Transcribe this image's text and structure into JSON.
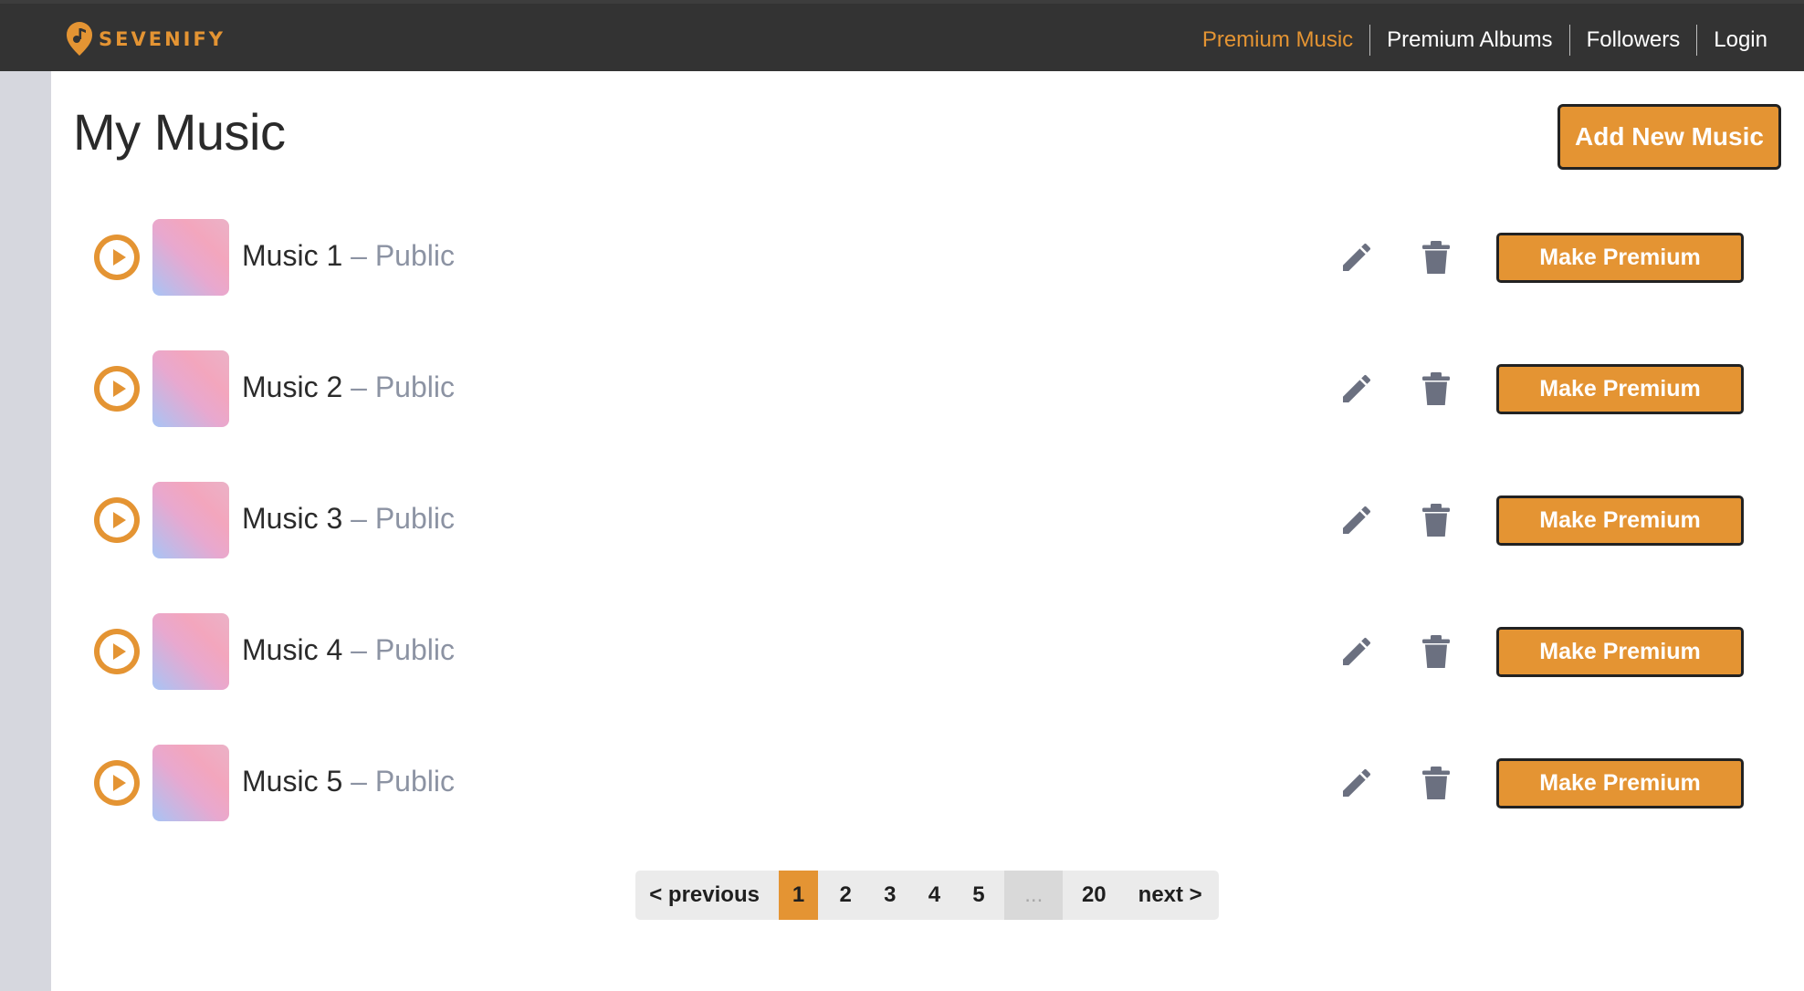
{
  "app": {
    "brand_name": "SEVENIFY",
    "accent_color": "#e49433",
    "navbar_color": "#333333"
  },
  "nav": {
    "links": [
      "Premium Music",
      "Premium Albums",
      "Followers",
      "Login"
    ],
    "active": "Premium Music"
  },
  "page": {
    "title": "My Music",
    "add_button": "Add New Music"
  },
  "tracks": [
    {
      "title": "Music 1",
      "visibility": "– Public",
      "action": "Make Premium"
    },
    {
      "title": "Music 2",
      "visibility": "– Public",
      "action": "Make Premium"
    },
    {
      "title": "Music 3",
      "visibility": "– Public",
      "action": "Make Premium"
    },
    {
      "title": "Music 4",
      "visibility": "– Public",
      "action": "Make Premium"
    },
    {
      "title": "Music 5",
      "visibility": "– Public",
      "action": "Make Premium"
    }
  ],
  "icons": {
    "play": "play-icon",
    "edit": "pencil-icon",
    "delete": "trash-icon",
    "brand": "music-note-icon"
  },
  "pagination": {
    "previous": "< previous",
    "pages": [
      "1",
      "2",
      "3",
      "4",
      "5"
    ],
    "current": "1",
    "ellipsis": "...",
    "last": "20",
    "next": "next >"
  }
}
